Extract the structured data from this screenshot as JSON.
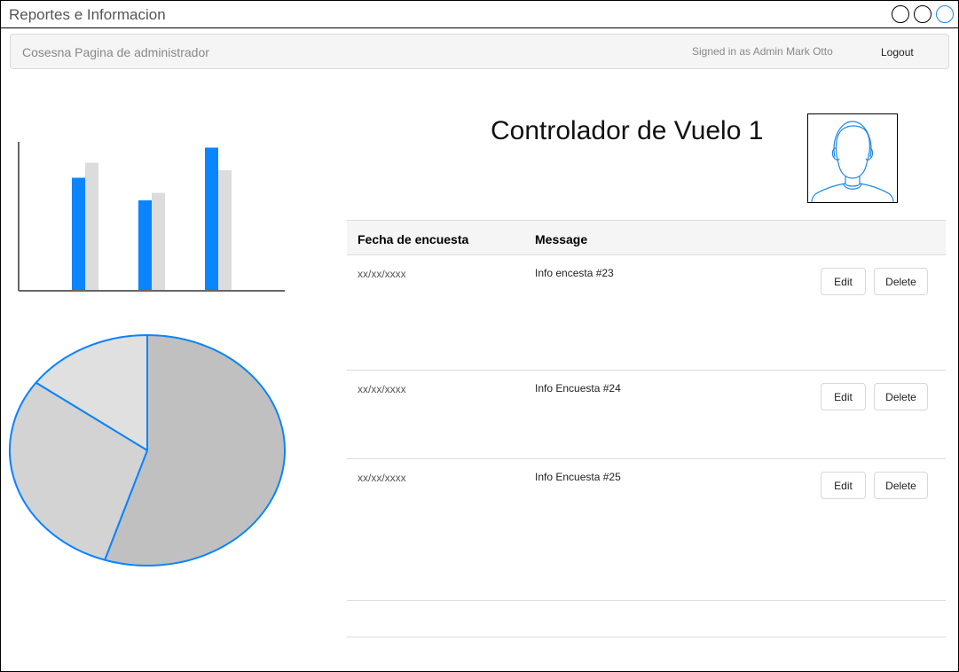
{
  "window": {
    "title": "Reportes e Informacion"
  },
  "navbar": {
    "brand": "Cosesna Pagina de administrador",
    "signed_in": "Signed in as Admin Mark Otto",
    "logout_label": "Logout"
  },
  "profile": {
    "name": "Controlador de Vuelo 1",
    "avatar_icon": "user-avatar-icon"
  },
  "table": {
    "headers": [
      "Fecha de encuesta",
      "Message"
    ],
    "rows": [
      {
        "date": "xx/xx/xxxx",
        "message": "Info encesta #23",
        "edit_label": "Edit",
        "delete_label": "Delete"
      },
      {
        "date": "xx/xx/xxxx",
        "message": "Info Encuesta #24",
        "edit_label": "Edit",
        "delete_label": "Delete"
      },
      {
        "date": "xx/xx/xxxx",
        "message": "Info Encuesta #25",
        "edit_label": "Edit",
        "delete_label": "Delete"
      }
    ]
  },
  "colors": {
    "accent": "#0a84ff",
    "secondary_bar": "#dcdcdc",
    "pie_large": "#c0c0c0",
    "pie_medium": "#d3d3d3",
    "pie_small": "#e0e0e0"
  },
  "chart_data": [
    {
      "type": "bar",
      "categories": [
        "",
        "",
        ""
      ],
      "series": [
        {
          "values": [
            75,
            60,
            95
          ]
        },
        {
          "values": [
            85,
            65,
            80
          ]
        }
      ],
      "ylim": [
        0,
        100
      ],
      "grid": false
    },
    {
      "type": "pie",
      "values": [
        55,
        30,
        15
      ],
      "colors": [
        "#c0c0c0",
        "#d3d3d3",
        "#e0e0e0"
      ]
    }
  ]
}
